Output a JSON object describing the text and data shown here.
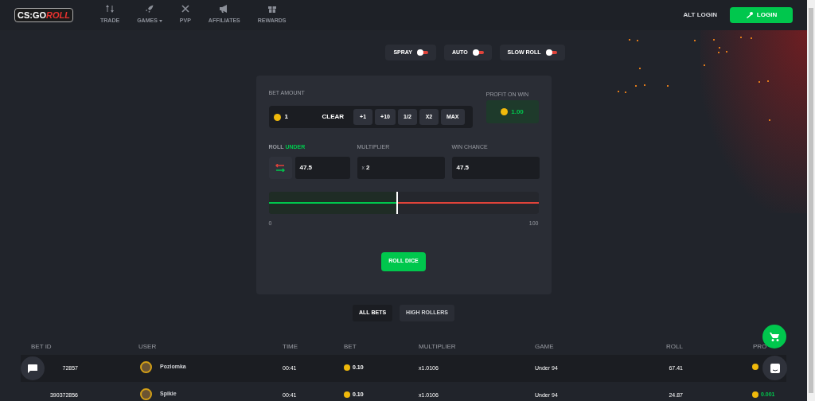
{
  "logo": {
    "text_1": "CS:GO",
    "text_2": "ROLL"
  },
  "nav": [
    {
      "label": "TRADE",
      "dropdown": false
    },
    {
      "label": "GAMES",
      "dropdown": true
    },
    {
      "label": "PVP",
      "dropdown": false
    },
    {
      "label": "AFFILIATES",
      "dropdown": false
    },
    {
      "label": "REWARDS",
      "dropdown": false
    }
  ],
  "alt_login": "ALT LOGIN",
  "login": "LOGIN",
  "toggles": [
    {
      "label": "SPRAY",
      "on": false
    },
    {
      "label": "AUTO",
      "on": false
    },
    {
      "label": "SLOW ROLL",
      "on": false
    }
  ],
  "bet": {
    "label": "BET AMOUNT",
    "value": "1",
    "clear": "CLEAR",
    "buttons": [
      "+1",
      "+10",
      "1/2",
      "X2",
      "MAX"
    ]
  },
  "profit": {
    "label": "PROFIT ON WIN",
    "value": "1.00"
  },
  "roll": {
    "label": "ROLL",
    "mode": "UNDER",
    "value": "47.5"
  },
  "multiplier": {
    "label": "MULTIPLIER",
    "prefix": "x",
    "value": "2"
  },
  "win_chance": {
    "label": "WIN CHANCE",
    "value": "47.5"
  },
  "slider": {
    "level": 0.475,
    "min": "0",
    "max": "100"
  },
  "roll_button": "ROLL DICE",
  "tabs": [
    {
      "label": "ALL BETS",
      "selected": true
    },
    {
      "label": "HIGH ROLLERS",
      "selected": false
    }
  ],
  "table": {
    "columns": [
      "BET ID",
      "USER",
      "TIME",
      "BET",
      "MULTIPLIER",
      "GAME",
      "ROLL",
      "PRO"
    ],
    "rows": [
      {
        "bet_id": "72857",
        "user": "Poziomka",
        "time": "00:41",
        "bet": "0.10",
        "multiplier": "x1.0106",
        "game": "Under 94",
        "roll": "67.41"
      },
      {
        "bet_id": "390372856",
        "user": "Spikie",
        "time": "00:41",
        "bet": "0.10",
        "multiplier": "x1.0106",
        "game": "Under 94",
        "roll": "24.87",
        "profit": "0.001"
      }
    ]
  }
}
